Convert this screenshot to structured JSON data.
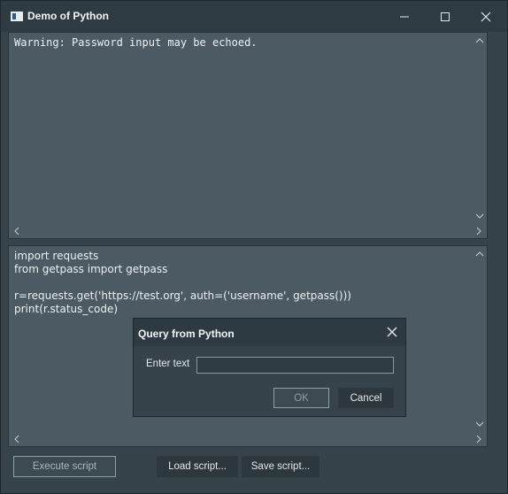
{
  "window": {
    "title": "Demo of Python",
    "controls": [
      "minimize",
      "maximize",
      "close"
    ]
  },
  "output": {
    "text": "Warning: Password input may be echoed."
  },
  "code": {
    "lines": [
      "import requests",
      "from getpass import getpass",
      "",
      "r=requests.get('https://test.org', auth=('username', getpass()))",
      "print(r.status_code)"
    ]
  },
  "buttons": {
    "execute": "Execute script",
    "load": "Load script...",
    "save": "Save script..."
  },
  "dialog": {
    "title": "Query from Python",
    "label": "Enter text",
    "input_value": "",
    "ok": "OK",
    "cancel": "Cancel"
  }
}
